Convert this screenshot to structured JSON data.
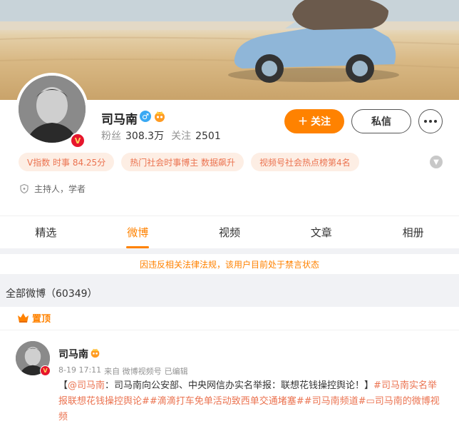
{
  "profile": {
    "name": "司马南",
    "gender_symbol": "♂",
    "verified_badge": "V",
    "followers_label": "粉丝",
    "followers_value": "308.3万",
    "following_label": "关注",
    "following_value": "2501",
    "follow_button": "关注",
    "follow_plus": "＋",
    "message_button": "私信",
    "identity": "主持人，学者"
  },
  "tags": [
    "V指数 时事 84.25分",
    "热门社会时事博主 数据飙升",
    "视频号社会热点榜第4名"
  ],
  "tabs": [
    "精选",
    "微博",
    "视频",
    "文章",
    "相册"
  ],
  "active_tab": "微博",
  "notice": "因违反相关法律法规，该用户目前处于禁言状态",
  "section_title": "全部微博（60349）",
  "post": {
    "pinned_label": "置顶",
    "author": "司马南",
    "time": "8-19 17:11",
    "source": "来自 微博视频号",
    "edited": "已编辑",
    "mention": "@司马南",
    "body_text": "：司马南向公安部、中央网信办实名举报：联想花钱操控舆论！】",
    "open_bracket": "【",
    "hashtags": "#司马南实名举报联想花钱操控舆论##滴滴打车免单活动致西单交通堵塞##司马南频道#",
    "video_icon_glyph": "▭",
    "video_link": "司马南的微博视频"
  },
  "colors": {
    "accent": "#ff8200",
    "tag_text": "#eb7350",
    "tag_bg": "#fdeee4",
    "verified_red": "#e6162d"
  }
}
